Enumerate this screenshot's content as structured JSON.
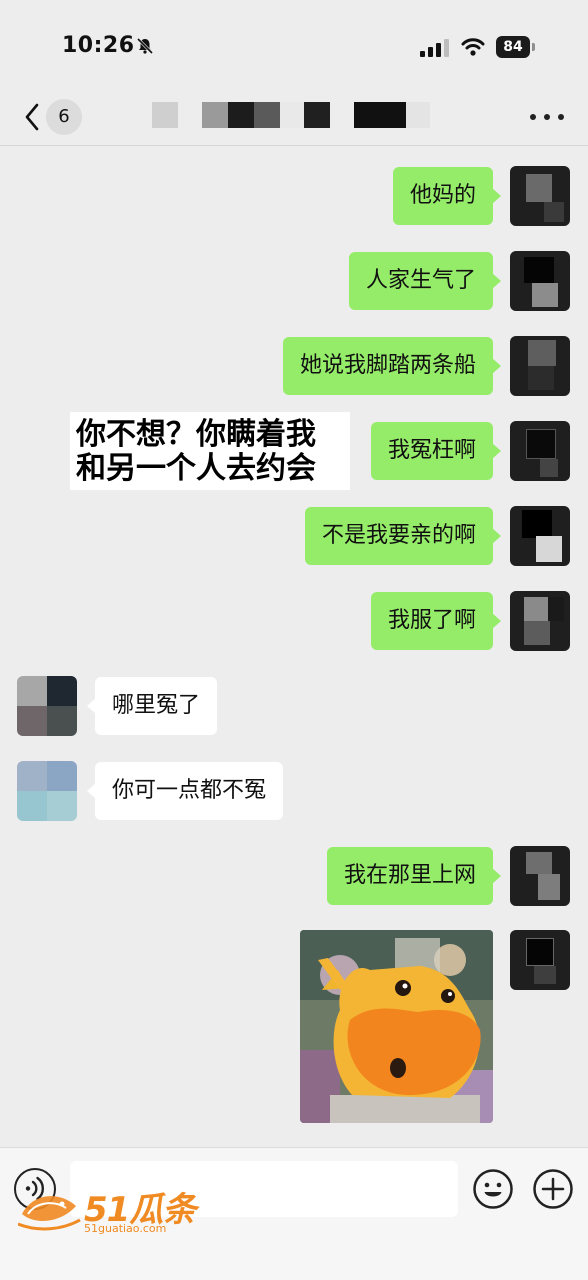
{
  "status_bar": {
    "time": "10:26",
    "battery": "84"
  },
  "nav": {
    "unread_count": "6",
    "more_icon": "ellipsis-icon",
    "back_icon": "chevron-left-icon"
  },
  "messages": [
    {
      "side": "me",
      "text": "他妈的"
    },
    {
      "side": "me",
      "text": "人家生气了"
    },
    {
      "side": "me",
      "text": "她说我脚踏两条船"
    },
    {
      "side": "me",
      "text": "我冤枉啊"
    },
    {
      "side": "me",
      "text": "不是我要亲的啊"
    },
    {
      "side": "me",
      "text": "我服了啊"
    },
    {
      "side": "other",
      "text": "哪里冤了"
    },
    {
      "side": "other",
      "text": "你可一点都不冤"
    },
    {
      "side": "me",
      "text": "我在那里上网"
    },
    {
      "side": "me",
      "type": "sticker",
      "description": "yellow cartoon character sticker"
    }
  ],
  "overlay_caption": {
    "line1": "你不想？你瞒着我",
    "line2": "和另一个人去约会"
  },
  "input_bar": {
    "placeholder": "",
    "voice_icon": "voice-icon",
    "emoji_icon": "emoji-icon",
    "plus_icon": "plus-icon"
  },
  "watermark": {
    "text": "51瓜条",
    "sub": "51guatiao.com"
  },
  "colors": {
    "background": "#ededed",
    "my_bubble": "#95ec69",
    "their_bubble": "#ffffff",
    "watermark": "#f08a22"
  }
}
